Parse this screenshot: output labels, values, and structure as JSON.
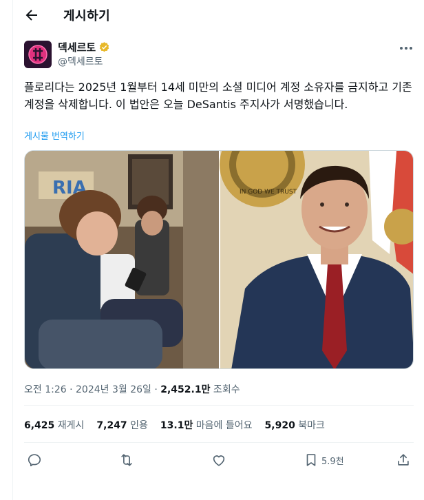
{
  "header": {
    "title": "게시하기"
  },
  "author": {
    "name": "덱세르토",
    "handle": "@덱세르토"
  },
  "post": {
    "text": "플로리다는 2025년 1월부터 14세 미만의 소셜 미디어 계정 소유자를 금지하고 기존 계정을 삭제합니다. 이 법안은 오늘 DeSantis 주지사가 서명했습니다.",
    "translate_label": "게시물 번역하기"
  },
  "meta": {
    "timestamp": "오전 1:26 · 2024년 3월 26일 · ",
    "views_count": "2,452.1만",
    "views_label": " 조회수"
  },
  "stats": {
    "reposts_count": "6,425",
    "reposts_label": " 재게시",
    "quotes_count": "7,247",
    "quotes_label": " 인용",
    "likes_count": "13.1만",
    "likes_label": " 마음에 들어요",
    "bookmarks_count": "5,920",
    "bookmarks_label": " 북마크"
  },
  "actions": {
    "bookmark_count": "5.9천"
  },
  "colors": {
    "accent": "#1d9bf0",
    "secondary_text": "#536471",
    "verified": "#e8b829"
  },
  "icons": [
    "back-arrow-icon",
    "verified-badge-icon",
    "more-options-icon",
    "reply-icon",
    "repost-icon",
    "like-icon",
    "bookmark-icon",
    "share-icon"
  ]
}
